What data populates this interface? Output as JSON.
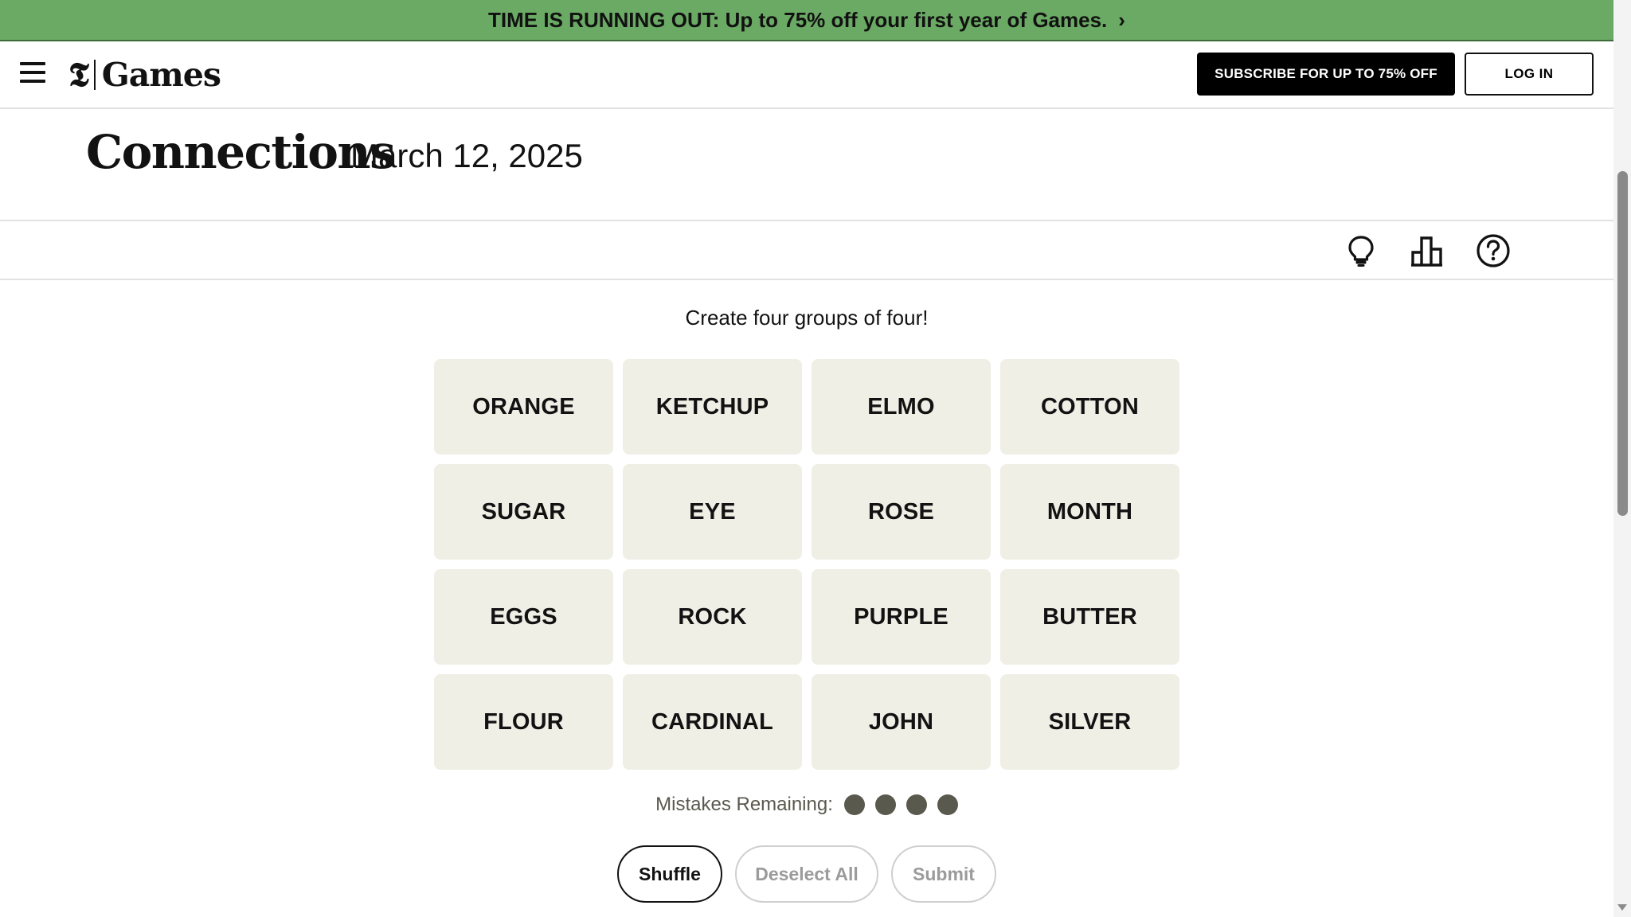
{
  "promo_banner": {
    "text": "TIME IS RUNNING OUT: Up to 75% off your first year of Games.",
    "chevron": "›"
  },
  "header": {
    "logo_mark": "𝕿",
    "logo_text": "Games",
    "subscribe_label": "SUBSCRIBE FOR UP TO 75% OFF",
    "login_label": "LOG IN"
  },
  "game": {
    "title": "Connections",
    "date": "March 12, 2025",
    "instructions": "Create four groups of four!",
    "tiles": [
      "ORANGE",
      "KETCHUP",
      "ELMO",
      "COTTON",
      "SUGAR",
      "EYE",
      "ROSE",
      "MONTH",
      "EGGS",
      "ROCK",
      "PURPLE",
      "BUTTER",
      "FLOUR",
      "CARDINAL",
      "JOHN",
      "SILVER"
    ],
    "mistakes_label": "Mistakes Remaining:",
    "mistakes_remaining": 4,
    "buttons": {
      "shuffle": "Shuffle",
      "deselect": "Deselect All",
      "submit": "Submit"
    }
  },
  "toolbar_icons": [
    "lightbulb-icon",
    "stats-icon",
    "help-icon"
  ],
  "colors": {
    "promo_bg": "#6aaa64",
    "tile_bg": "#efefe6",
    "dot": "#5a594e"
  }
}
